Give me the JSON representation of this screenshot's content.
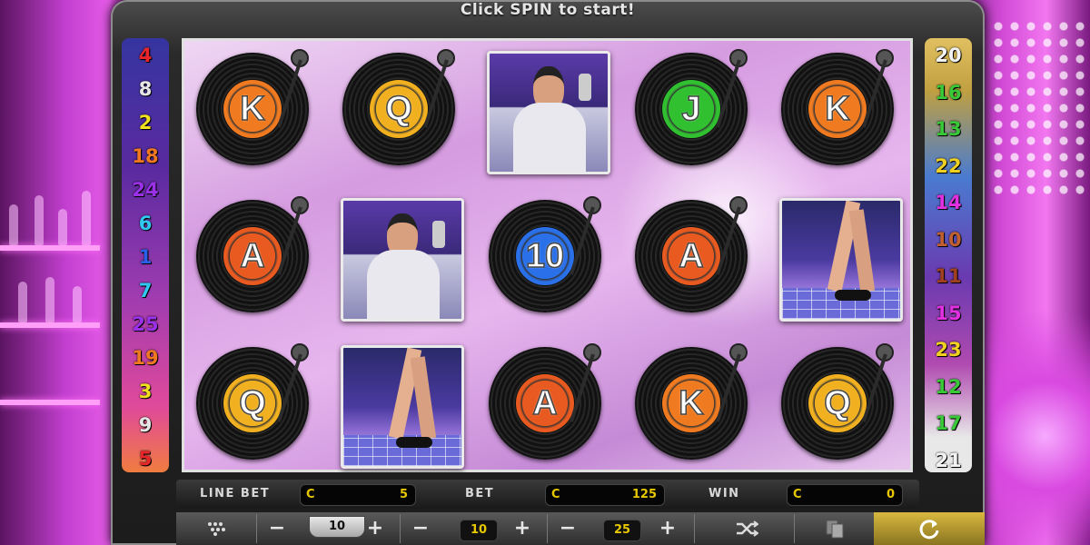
{
  "header": {
    "message": "Click SPIN to start!"
  },
  "paylines": {
    "left": [
      {
        "n": "4",
        "color": "#e8262a"
      },
      {
        "n": "8",
        "color": "#e6e6e6"
      },
      {
        "n": "2",
        "color": "#f0e020"
      },
      {
        "n": "18",
        "color": "#f07820"
      },
      {
        "n": "24",
        "color": "#9a30e8"
      },
      {
        "n": "6",
        "color": "#30c8f0"
      },
      {
        "n": "1",
        "color": "#2a60e8"
      },
      {
        "n": "7",
        "color": "#30c8f0"
      },
      {
        "n": "25",
        "color": "#9a30e8"
      },
      {
        "n": "19",
        "color": "#f07820"
      },
      {
        "n": "3",
        "color": "#f0e020"
      },
      {
        "n": "9",
        "color": "#e6e6e6"
      },
      {
        "n": "5",
        "color": "#e8262a"
      }
    ],
    "right": [
      {
        "n": "20",
        "color": "#f2f2f2"
      },
      {
        "n": "16",
        "color": "#38c838"
      },
      {
        "n": "13",
        "color": "#38c838"
      },
      {
        "n": "22",
        "color": "#f0d020"
      },
      {
        "n": "14",
        "color": "#e030e0"
      },
      {
        "n": "10",
        "color": "#c06030"
      },
      {
        "n": "11",
        "color": "#a04020"
      },
      {
        "n": "15",
        "color": "#e030e0"
      },
      {
        "n": "23",
        "color": "#f0d020"
      },
      {
        "n": "12",
        "color": "#38c838"
      },
      {
        "n": "17",
        "color": "#38c838"
      },
      {
        "n": "21",
        "color": "#f2f2f2"
      }
    ]
  },
  "reels": [
    [
      {
        "type": "record",
        "letter": "K",
        "color": "#f07a20"
      },
      {
        "type": "record",
        "letter": "A",
        "color": "#e85a20"
      },
      {
        "type": "record",
        "letter": "Q",
        "color": "#f0b020"
      }
    ],
    [
      {
        "type": "record",
        "letter": "Q",
        "color": "#f0b020"
      },
      {
        "type": "picture",
        "kind": "bartender",
        "icon": "bartender-icon"
      },
      {
        "type": "picture",
        "kind": "dancer",
        "icon": "dancer-legs-icon"
      }
    ],
    [
      {
        "type": "picture",
        "kind": "bartender",
        "icon": "bartender-icon"
      },
      {
        "type": "record",
        "letter": "10",
        "color": "#2a70e8"
      },
      {
        "type": "record",
        "letter": "A",
        "color": "#e85a20"
      }
    ],
    [
      {
        "type": "record",
        "letter": "J",
        "color": "#30c030"
      },
      {
        "type": "record",
        "letter": "A",
        "color": "#e85a20"
      },
      {
        "type": "record",
        "letter": "K",
        "color": "#f07a20"
      }
    ],
    [
      {
        "type": "record",
        "letter": "K",
        "color": "#f07a20"
      },
      {
        "type": "picture",
        "kind": "dancer",
        "icon": "dancer-legs-icon"
      },
      {
        "type": "record",
        "letter": "Q",
        "color": "#f0b020"
      }
    ]
  ],
  "meters": {
    "line_bet": {
      "label": "LINE BET",
      "currency": "C",
      "value": "5"
    },
    "bet": {
      "label": "BET",
      "currency": "C",
      "value": "125"
    },
    "win": {
      "label": "WIN",
      "currency": "C",
      "value": "0"
    }
  },
  "controls": {
    "menu_icon": "grid-dots-icon",
    "coin_value": "10",
    "bet_level": "10",
    "lines": "25",
    "minus": "−",
    "plus": "+",
    "shuffle_icon": "shuffle-icon",
    "cards_icon": "cards-icon",
    "spin_icon": "spin-arrow-icon"
  }
}
